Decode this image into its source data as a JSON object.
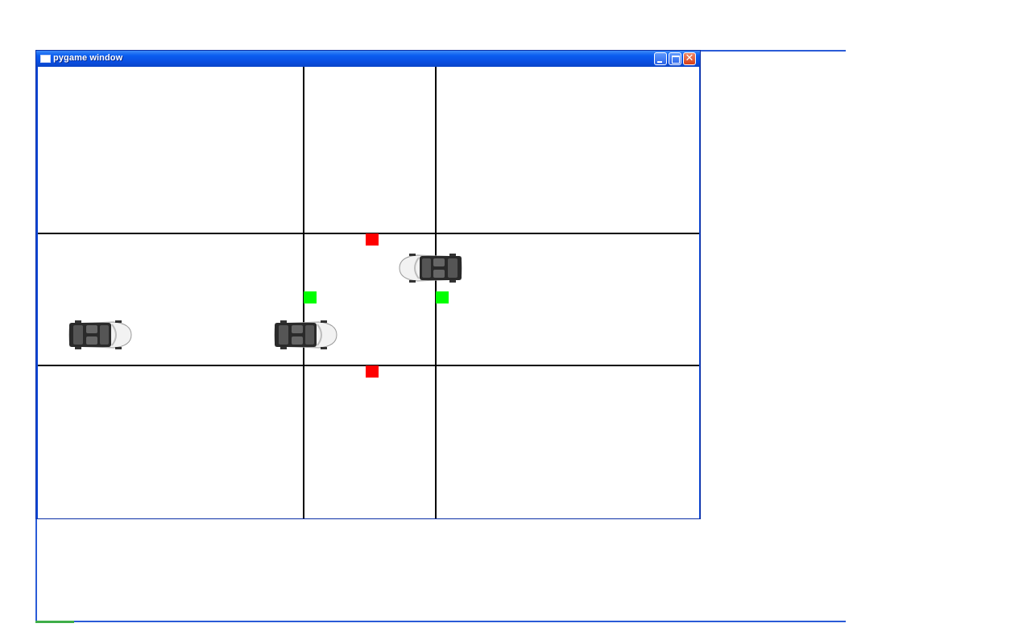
{
  "window": {
    "title": "pygame window",
    "buttons": [
      "minimize",
      "maximize",
      "close"
    ]
  },
  "scene": {
    "background": "#ffffff",
    "line_color": "#000000",
    "signals": [
      {
        "name": "north-signal",
        "color": "#ff0000",
        "state": "red"
      },
      {
        "name": "south-signal",
        "color": "#ff0000",
        "state": "red"
      },
      {
        "name": "west-signal",
        "color": "#00ff00",
        "state": "green"
      },
      {
        "name": "east-signal",
        "color": "#00ff00",
        "state": "green"
      }
    ],
    "cars": [
      {
        "name": "car-westbound-lane",
        "direction": "left"
      },
      {
        "name": "car-eastbound-left",
        "direction": "right"
      },
      {
        "name": "car-eastbound-intersection",
        "direction": "right"
      }
    ],
    "icons": {
      "app": "window-icon",
      "minimize": "minimize-icon",
      "maximize": "maximize-icon",
      "close": "close-icon"
    }
  }
}
